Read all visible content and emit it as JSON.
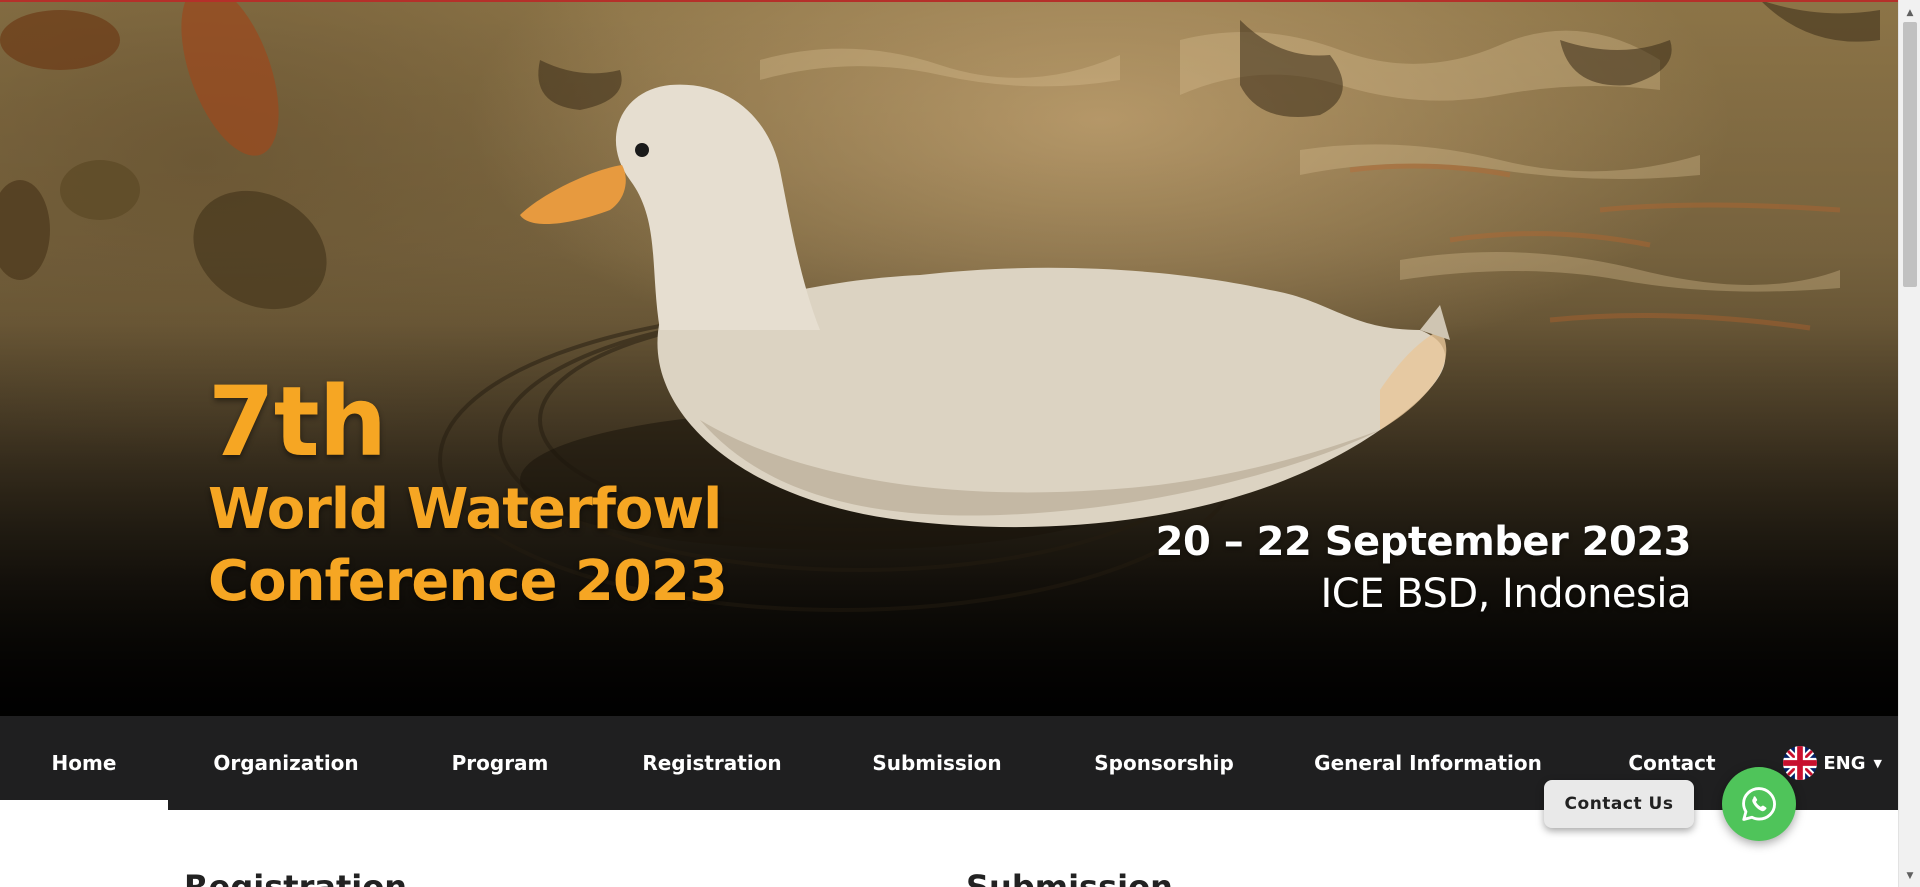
{
  "hero": {
    "ordinal": "7th",
    "title_line1": "World Waterfowl",
    "title_line2": "Conference 2023",
    "date": "20 – 22 September 2023",
    "venue": "ICE BSD, Indonesia"
  },
  "nav": {
    "items": [
      {
        "label": "Home",
        "active": true
      },
      {
        "label": "Organization"
      },
      {
        "label": "Program"
      },
      {
        "label": "Registration"
      },
      {
        "label": "Submission"
      },
      {
        "label": "Sponsorship"
      },
      {
        "label": "General Information"
      },
      {
        "label": "Contact"
      }
    ],
    "language": "ENG"
  },
  "content": {
    "heading_left": "Registration",
    "heading_right": "Submission"
  },
  "floating": {
    "contact_label": "Contact Us",
    "whatsapp_icon": "whatsapp-icon"
  },
  "colors": {
    "accent": "#f6a623",
    "nav_bg": "#1f1f20",
    "whatsapp": "#4fc45a"
  }
}
